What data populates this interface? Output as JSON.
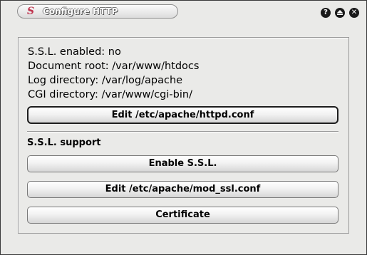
{
  "window": {
    "title": "Configure HTTP",
    "app_icon_glyph": "S",
    "app_icon_color": "#c0344e",
    "buttons": {
      "help": "?",
      "close": "✕"
    }
  },
  "info": {
    "ssl_enabled": "S.S.L. enabled: no",
    "document_root": "Document root: /var/www/htdocs",
    "log_directory": "Log directory: /var/log/apache",
    "cgi_directory": "CGI directory: /var/www/cgi-bin/"
  },
  "actions": {
    "edit_httpd": "Edit /etc/apache/httpd.conf",
    "ssl_section": "S.S.L. support",
    "enable_ssl": "Enable S.S.L.",
    "edit_mod_ssl": "Edit /etc/apache/mod_ssl.conf",
    "certificate": "Certificate"
  }
}
